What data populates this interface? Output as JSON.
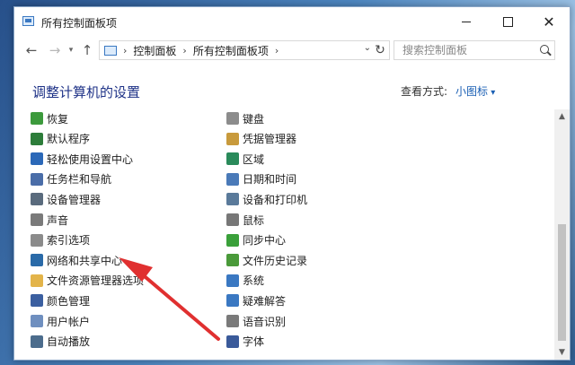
{
  "window": {
    "title": "所有控制面板项",
    "icon": "control-panel-icon"
  },
  "address": {
    "crumbs": [
      "控制面板",
      "所有控制面板项"
    ],
    "search_placeholder": "搜索控制面板"
  },
  "header": {
    "heading": "调整计算机的设置",
    "view_by_label": "查看方式:",
    "view_by_value": "小图标"
  },
  "left_items": [
    {
      "label": "恢复",
      "icon": "recovery-icon",
      "color": "#3c9a3c"
    },
    {
      "label": "默认程序",
      "icon": "default-programs-icon",
      "color": "#2d7d3a"
    },
    {
      "label": "轻松使用设置中心",
      "icon": "ease-of-access-icon",
      "color": "#2b68b8"
    },
    {
      "label": "任务栏和导航",
      "icon": "taskbar-icon",
      "color": "#4a6da8"
    },
    {
      "label": "设备管理器",
      "icon": "device-manager-icon",
      "color": "#5a6b7d"
    },
    {
      "label": "声音",
      "icon": "sound-icon",
      "color": "#7a7a7a"
    },
    {
      "label": "索引选项",
      "icon": "indexing-icon",
      "color": "#8b8b8b"
    },
    {
      "label": "网络和共享中心",
      "icon": "network-icon",
      "color": "#2a6aa8"
    },
    {
      "label": "文件资源管理器选项",
      "icon": "folder-options-icon",
      "color": "#e3b44a"
    },
    {
      "label": "颜色管理",
      "icon": "color-management-icon",
      "color": "#3b5fa0"
    },
    {
      "label": "用户帐户",
      "icon": "user-accounts-icon",
      "color": "#6f8fbf"
    },
    {
      "label": "自动播放",
      "icon": "autoplay-icon",
      "color": "#4c6c8c"
    }
  ],
  "right_items": [
    {
      "label": "键盘",
      "icon": "keyboard-icon",
      "color": "#8c8c8c"
    },
    {
      "label": "凭据管理器",
      "icon": "credential-manager-icon",
      "color": "#c89a3c"
    },
    {
      "label": "区域",
      "icon": "region-icon",
      "color": "#2a8a5a"
    },
    {
      "label": "日期和时间",
      "icon": "date-time-icon",
      "color": "#4a7ab8"
    },
    {
      "label": "设备和打印机",
      "icon": "devices-printers-icon",
      "color": "#5a7a9a"
    },
    {
      "label": "鼠标",
      "icon": "mouse-icon",
      "color": "#777777"
    },
    {
      "label": "同步中心",
      "icon": "sync-center-icon",
      "color": "#3aa03a"
    },
    {
      "label": "文件历史记录",
      "icon": "file-history-icon",
      "color": "#4a9a3a"
    },
    {
      "label": "系统",
      "icon": "system-icon",
      "color": "#3a78c2"
    },
    {
      "label": "疑难解答",
      "icon": "troubleshooting-icon",
      "color": "#3a78c2"
    },
    {
      "label": "语音识别",
      "icon": "speech-recognition-icon",
      "color": "#7a7a7a"
    },
    {
      "label": "字体",
      "icon": "fonts-icon",
      "color": "#3a5a9a"
    }
  ],
  "annotation_color": "#e03030"
}
